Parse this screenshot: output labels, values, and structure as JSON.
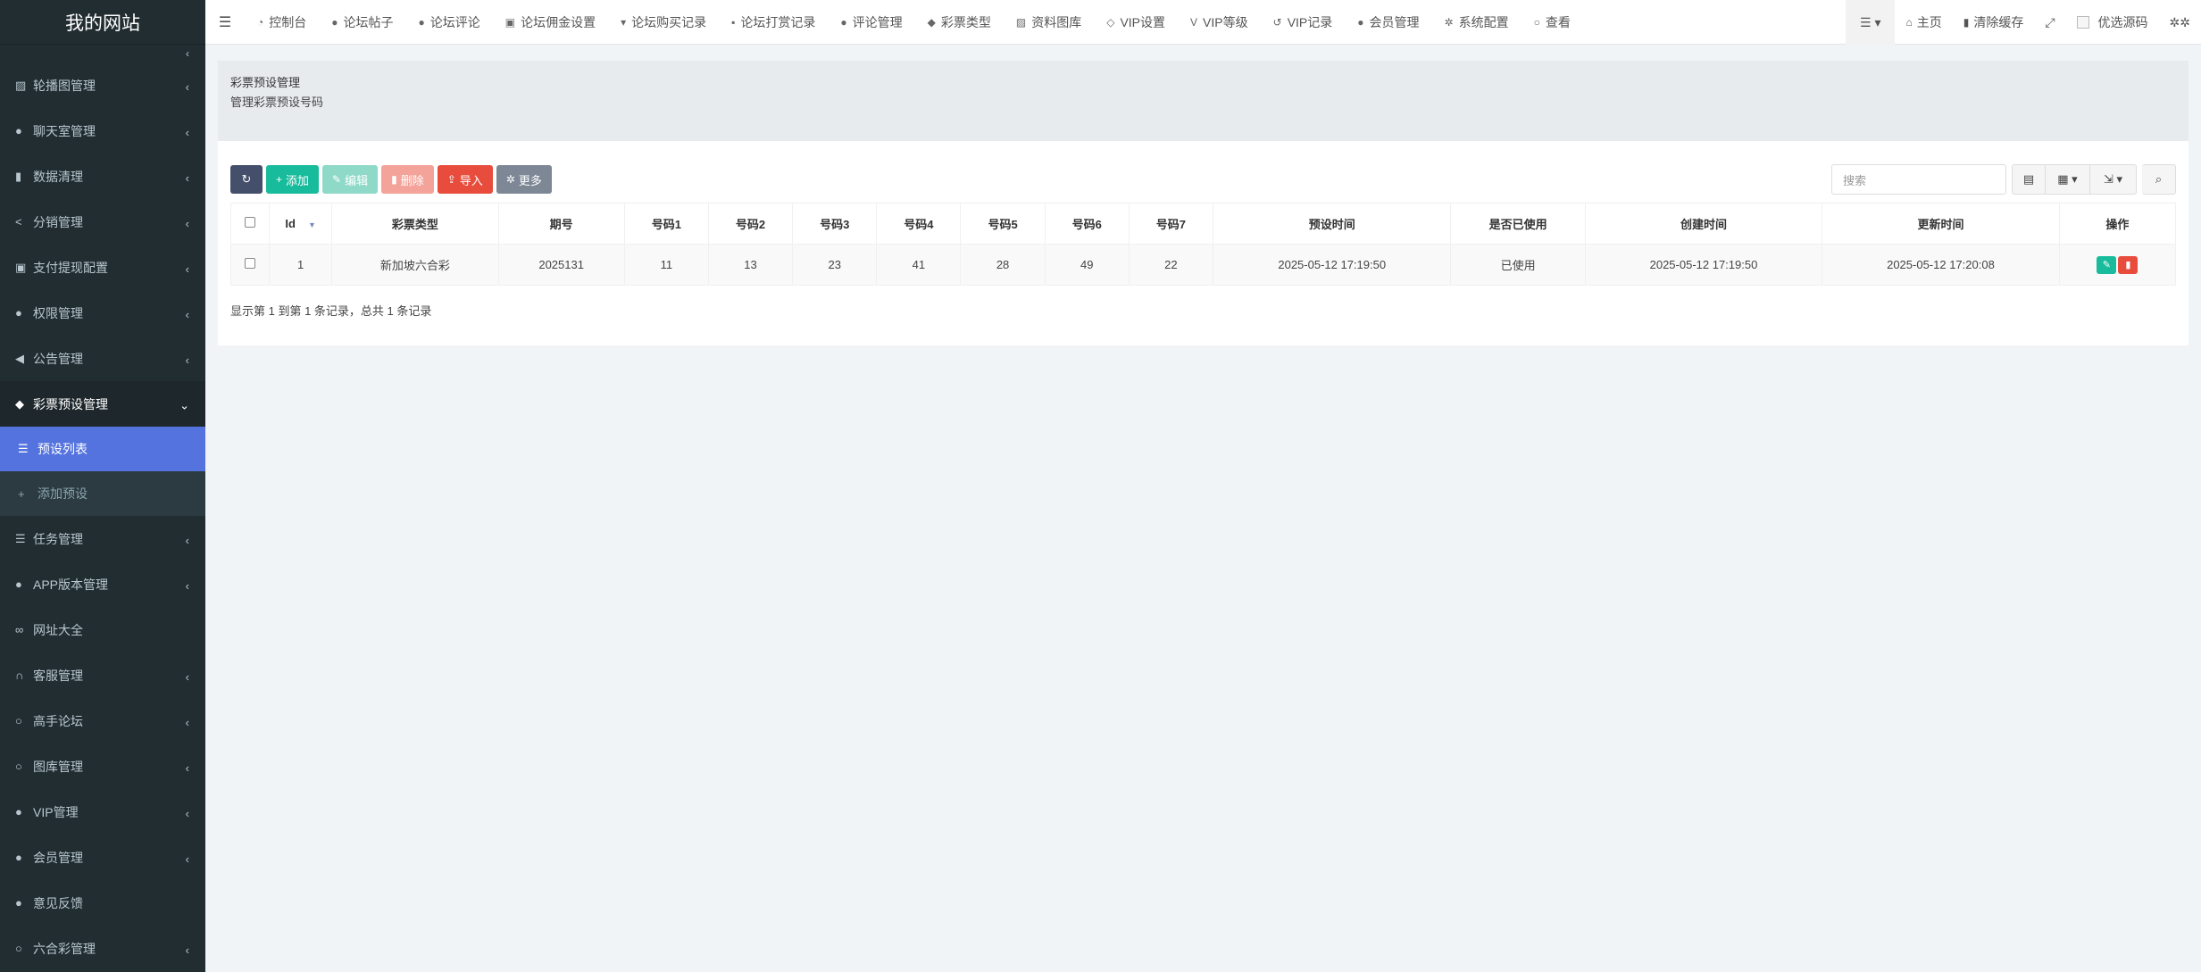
{
  "app": {
    "logo": "我的网站"
  },
  "topnav": {
    "items": [
      {
        "label": "控制台",
        "icon": "dashboard-icon",
        "glyph": "◔"
      },
      {
        "label": "论坛帖子",
        "icon": "comment-icon",
        "glyph": "●"
      },
      {
        "label": "论坛评论",
        "icon": "comments-icon",
        "glyph": "●"
      },
      {
        "label": "论坛佣金设置",
        "icon": "money-icon",
        "glyph": "▣"
      },
      {
        "label": "论坛购买记录",
        "icon": "cart-icon",
        "glyph": "▾"
      },
      {
        "label": "论坛打赏记录",
        "icon": "gift-icon",
        "glyph": "▪"
      },
      {
        "label": "评论管理",
        "icon": "comments-icon",
        "glyph": "●"
      },
      {
        "label": "彩票类型",
        "icon": "tag-icon",
        "glyph": "◆"
      },
      {
        "label": "资料图库",
        "icon": "image-icon",
        "glyph": "▨"
      },
      {
        "label": "VIP设置",
        "icon": "diamond-icon",
        "glyph": "◇"
      },
      {
        "label": "VIP等级",
        "icon": "vimeo-icon",
        "glyph": "V"
      },
      {
        "label": "VIP记录",
        "icon": "history-icon",
        "glyph": "↺"
      },
      {
        "label": "会员管理",
        "icon": "user-icon",
        "glyph": "●"
      },
      {
        "label": "系统配置",
        "icon": "cog-icon",
        "glyph": "✲"
      },
      {
        "label": "查看",
        "icon": "circle-icon",
        "glyph": "○"
      }
    ],
    "right": {
      "home": "主页",
      "clear_cache": "清除缓存",
      "username": "优选源码"
    }
  },
  "sidebar": {
    "items": [
      {
        "label": "轮播图管理",
        "icon": "image-icon",
        "glyph": "▨",
        "chevron": true
      },
      {
        "label": "聊天室管理",
        "icon": "comments-icon",
        "glyph": "●",
        "chevron": true
      },
      {
        "label": "数据清理",
        "icon": "trash-icon",
        "glyph": "▮",
        "chevron": true
      },
      {
        "label": "分销管理",
        "icon": "share-icon",
        "glyph": "<",
        "chevron": true
      },
      {
        "label": "支付提现配置",
        "icon": "money-icon",
        "glyph": "▣",
        "chevron": true
      },
      {
        "label": "权限管理",
        "icon": "group-icon",
        "glyph": "●",
        "chevron": true
      },
      {
        "label": "公告管理",
        "icon": "bullhorn-icon",
        "glyph": "◀",
        "chevron": true
      },
      {
        "label": "彩票预设管理",
        "icon": "tag-icon",
        "glyph": "◆",
        "chevron": true,
        "active": true
      }
    ],
    "sub_items": [
      {
        "label": "预设列表",
        "icon": "list-icon",
        "glyph": "☰",
        "selected": true
      },
      {
        "label": "添加预设",
        "icon": "plus-icon",
        "glyph": "+",
        "selected": false
      }
    ],
    "items_after": [
      {
        "label": "任务管理",
        "icon": "tasks-icon",
        "glyph": "☰",
        "chevron": true
      },
      {
        "label": "APP版本管理",
        "icon": "android-icon",
        "glyph": "●",
        "chevron": true
      },
      {
        "label": "网址大全",
        "icon": "link-icon",
        "glyph": "∞",
        "chevron": false
      },
      {
        "label": "客服管理",
        "icon": "headset-icon",
        "glyph": "∩",
        "chevron": true
      },
      {
        "label": "高手论坛",
        "icon": "circle-icon",
        "glyph": "○",
        "chevron": true
      },
      {
        "label": "图库管理",
        "icon": "circle-icon",
        "glyph": "○",
        "chevron": true
      },
      {
        "label": "VIP管理",
        "icon": "github-icon",
        "glyph": "●",
        "chevron": true
      },
      {
        "label": "会员管理",
        "icon": "user-circle-icon",
        "glyph": "●",
        "chevron": true
      },
      {
        "label": "意见反馈",
        "icon": "comment-icon",
        "glyph": "●",
        "chevron": false
      },
      {
        "label": "六合彩管理",
        "icon": "circle-icon",
        "glyph": "○",
        "chevron": true
      }
    ]
  },
  "page": {
    "title": "彩票预设管理",
    "subtitle": "管理彩票预设号码"
  },
  "toolbar": {
    "add": "添加",
    "edit": "编辑",
    "delete": "删除",
    "import": "导入",
    "more": "更多",
    "search_placeholder": "搜索"
  },
  "table": {
    "columns": [
      "Id",
      "彩票类型",
      "期号",
      "号码1",
      "号码2",
      "号码3",
      "号码4",
      "号码5",
      "号码6",
      "号码7",
      "预设时间",
      "是否已使用",
      "创建时间",
      "更新时间",
      "操作"
    ],
    "rows": [
      [
        "1",
        "新加坡六合彩",
        "2025131",
        "11",
        "13",
        "23",
        "41",
        "28",
        "49",
        "22",
        "2025-05-12 17:19:50",
        "已使用",
        "2025-05-12 17:19:50",
        "2025-05-12 17:20:08"
      ]
    ],
    "summary": "显示第 1 到第 1 条记录，总共 1 条记录"
  },
  "colors": {
    "sidebar_bg": "#222d32",
    "sidebar_selected": "#5573de",
    "add": "#18bc9c",
    "import": "#e74c3c"
  }
}
